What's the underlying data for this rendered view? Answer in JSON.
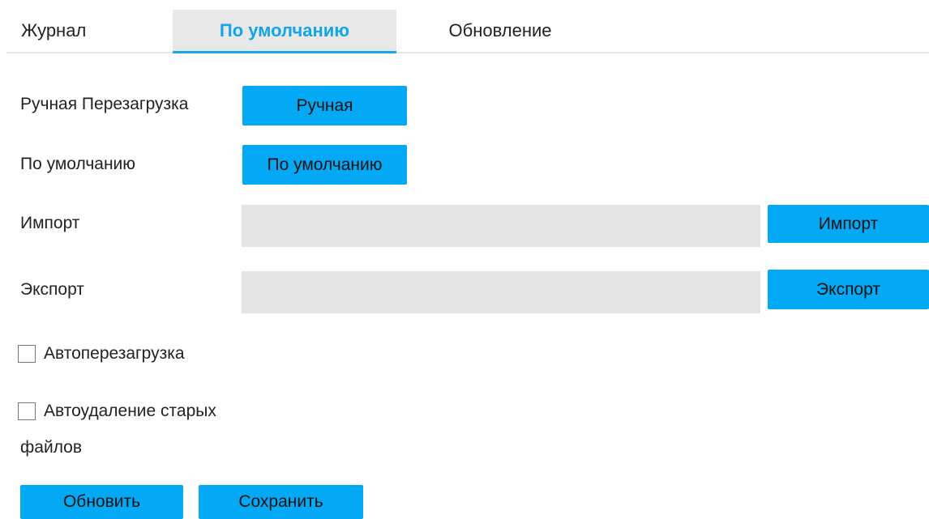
{
  "tabs": [
    {
      "label": "Журнал"
    },
    {
      "label": "По умолчанию"
    },
    {
      "label": "Обновление"
    }
  ],
  "active_tab": "По умолчанию",
  "rows": {
    "manual_reboot": {
      "label": "Ручная Перезагрузка",
      "button": "Ручная"
    },
    "default": {
      "label": "По умолчанию",
      "button": "По умолчанию"
    },
    "import": {
      "label": "Импорт",
      "value": "",
      "button": "Импорт"
    },
    "export": {
      "label": "Экспорт",
      "value": "",
      "button": "Экспорт"
    }
  },
  "checkboxes": {
    "auto_reboot": {
      "label": "Автоперезагрузка",
      "checked": false
    },
    "auto_delete": {
      "label_line1": "Автоудаление старых",
      "label_line2": "файлов",
      "checked": false
    }
  },
  "footer": {
    "refresh_label": "Обновить",
    "save_label": "Сохранить"
  },
  "colors": {
    "accent": "#03a9f4",
    "active_tab_text": "#12a5e8",
    "active_tab_bg": "#e8e8e8",
    "field_bg": "#e3e3e3"
  }
}
